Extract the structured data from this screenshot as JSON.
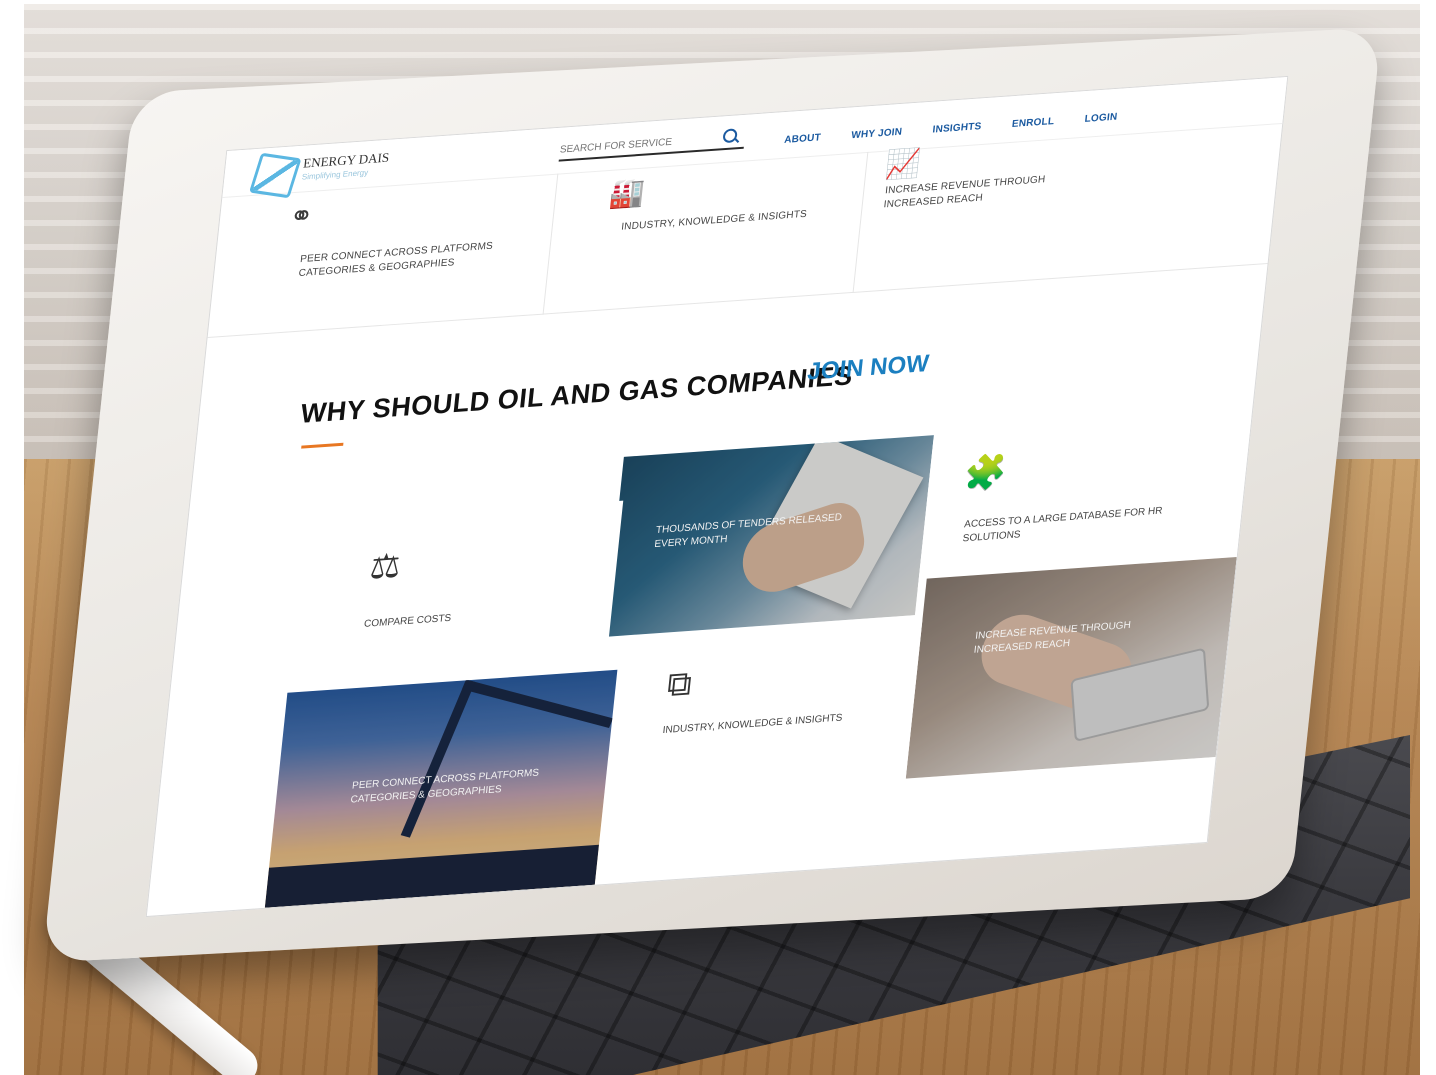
{
  "brand": {
    "name": "ENERGY DAIS",
    "tagline": "Simplifying Energy"
  },
  "search": {
    "placeholder": "SEARCH FOR SERVICE"
  },
  "nav": [
    "ABOUT",
    "WHY JOIN",
    "INSIGHTS",
    "ENROLL",
    "LOGIN"
  ],
  "top_features": [
    {
      "icon": "network-nodes-icon",
      "label": "PEER CONNECT ACROSS PLATFORMS CATEGORIES & GEOGRAPHIES"
    },
    {
      "icon": "factory-icon",
      "label": "INDUSTRY, KNOWLEDGE & INSIGHTS"
    },
    {
      "icon": "growth-chart-icon",
      "label": "INCREASE REVENUE THROUGH INCREASED REACH"
    }
  ],
  "why": {
    "title": "WHY SHOULD OIL AND GAS COMPANIES",
    "cta": "JOIN NOW"
  },
  "tiles": {
    "tenders": "THOUSANDS OF TENDERS RELEASED EVERY MONTH",
    "access": "ACCESS TO A LARGE DATABASE FOR HR SOLUTIONS",
    "compare": "COMPARE COSTS",
    "revenue": "INCREASE REVENUE THROUGH INCREASED REACH",
    "peer": "PEER CONNECT ACROSS PLATFORMS CATEGORIES & GEOGRAPHIES",
    "industry": "INDUSTRY, KNOWLEDGE & INSIGHTS"
  },
  "icons": {
    "tiles_access": "puzzle-icon",
    "tiles_compare": "scales-icon",
    "tiles_industry": "hierarchy-icon"
  },
  "colors": {
    "link": "#1b5aa0",
    "join": "#1b7fc0",
    "accent": "#e87722"
  }
}
